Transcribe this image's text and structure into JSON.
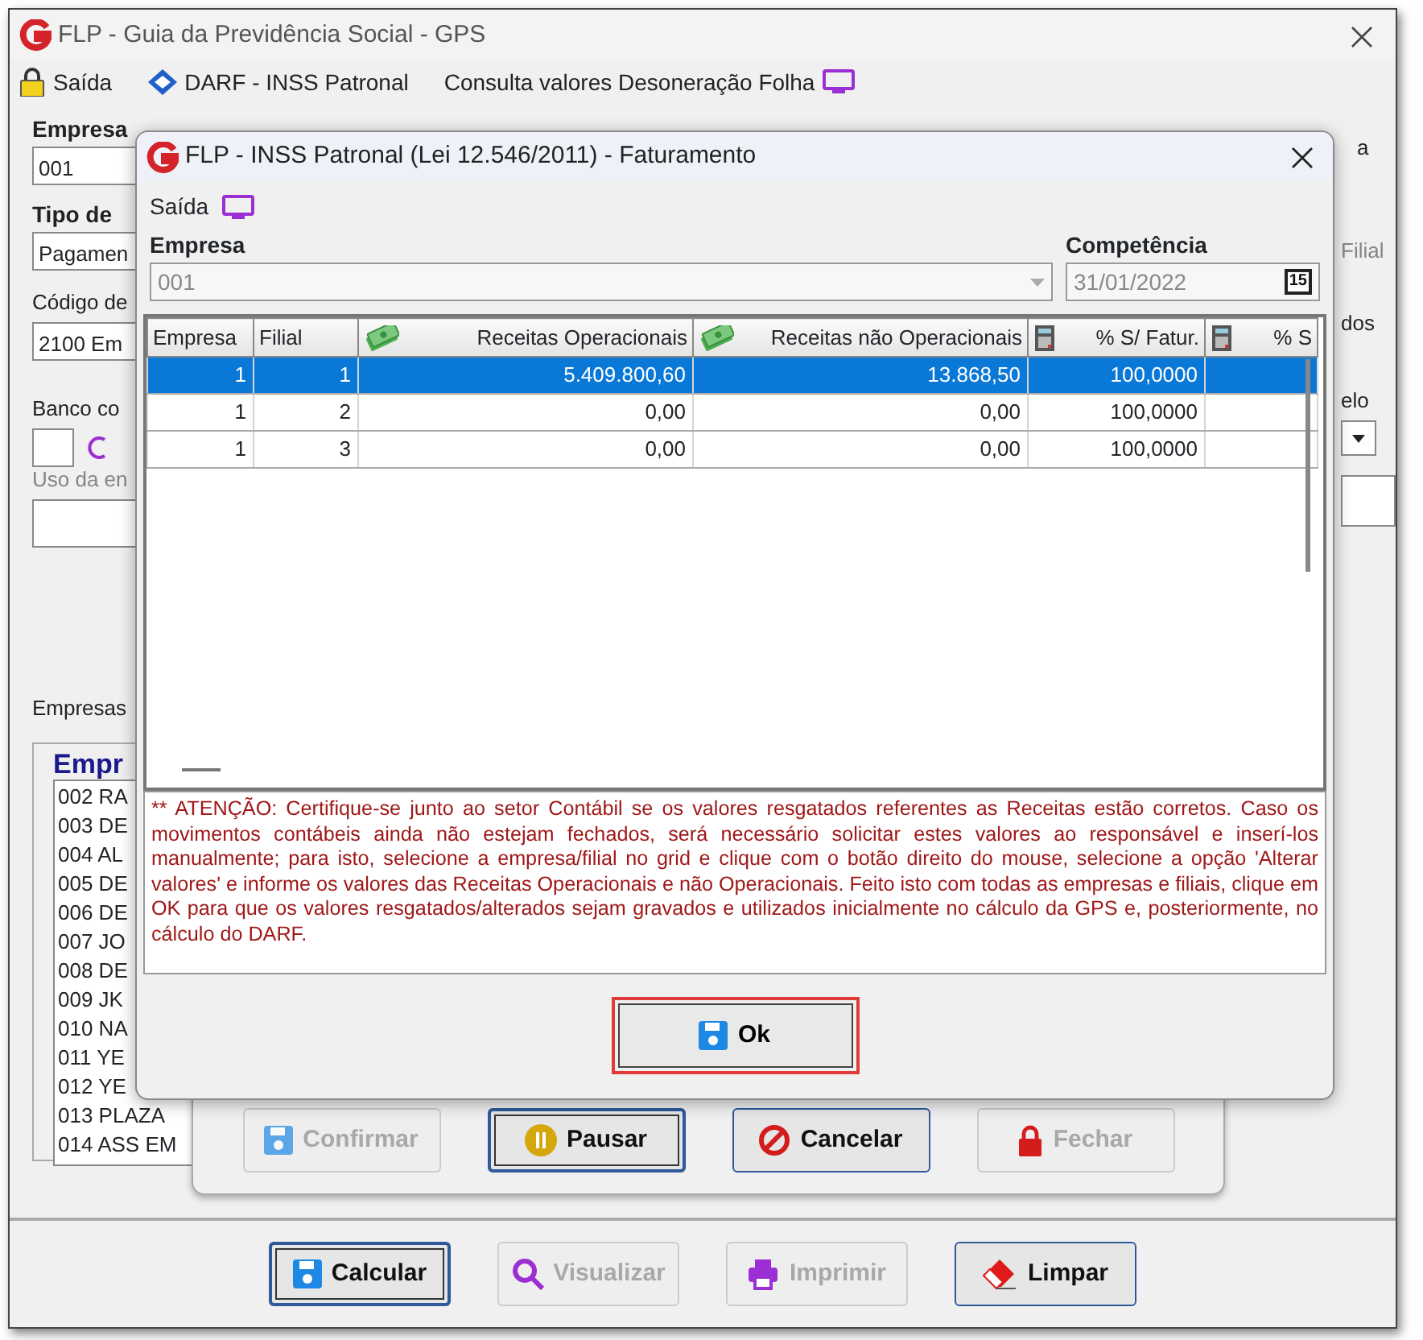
{
  "window": {
    "title": "FLP - Guia da Previdência Social - GPS"
  },
  "menu": [
    {
      "label": "Saída",
      "kind": "lock"
    },
    {
      "label": "DARF - INSS Patronal",
      "kind": "darf"
    },
    {
      "label": "Consulta valores Desoneração Folha",
      "kind": "monitor"
    }
  ],
  "main_form": {
    "empresa_label": "Empresa",
    "empresa_value": "001",
    "tipo_label": "Tipo de",
    "tipo_value": "Pagamen",
    "codigo_label": "Código de",
    "codigo_value": "2100  Em",
    "banco_label": "Banco co",
    "uso_label": "Uso da en",
    "tab": "Empresas",
    "list_header": "Empr",
    "list_items": [
      "002 RA",
      "003 DE",
      "004 AL",
      "005 DE",
      "006 DE",
      "007 JO",
      "008 DE",
      "009 JK",
      "010 NA",
      "011 YE",
      "012 YE",
      "013 PLAZA",
      "014 ASS EM"
    ]
  },
  "right_fragments": {
    "option": "a",
    "filial": "Filial",
    "dos": "dos",
    "elo": "elo"
  },
  "dialog": {
    "title": "FLP - INSS Patronal (Lei 12.546/2011) - Faturamento",
    "menu_label": "Saída",
    "empresa_label": "Empresa",
    "empresa_value": "001",
    "competencia_label": "Competência",
    "competencia_value": "31/01/2022",
    "calendar_day": "15",
    "grid": {
      "columns": [
        {
          "label": "Empresa"
        },
        {
          "label": "Filial"
        },
        {
          "label": "Receitas Operacionais"
        },
        {
          "label": "Receitas não Operacionais"
        },
        {
          "label": "% S/ Fatur."
        },
        {
          "label": "% S"
        }
      ],
      "rows": [
        {
          "selected": true,
          "cells": [
            "1",
            "1",
            "5.409.800,60",
            "13.868,50",
            "100,0000",
            ""
          ]
        },
        {
          "selected": false,
          "cells": [
            "1",
            "2",
            "0,00",
            "0,00",
            "100,0000",
            ""
          ]
        },
        {
          "selected": false,
          "cells": [
            "1",
            "3",
            "0,00",
            "0,00",
            "100,0000",
            ""
          ]
        }
      ]
    },
    "notice": "** ATENÇÃO:  Certifique-se junto ao setor Contábil se os valores resgatados referentes as Receitas estão corretos. Caso os movimentos contábeis ainda não estejam fechados, será necessário solicitar estes valores ao responsável e inserí-los manualmente; para isto, selecione a empresa/filial no grid e clique com o botão direito do mouse, selecione a opção 'Alterar valores' e informe os valores das Receitas Operacionais e não Operacionais.   Feito isto com todas as empresas e filiais, clique em OK para que os valores resgatados/alterados sejam gravados e utilizados inicialmente no cálculo da GPS e, posteriormente, no cálculo do DARF.",
    "ok_button": "Ok"
  },
  "progress_buttons": [
    {
      "label": "Confirmar",
      "kind": "floppy",
      "disabled": true,
      "focused": false
    },
    {
      "label": "Pausar",
      "kind": "pause",
      "disabled": false,
      "focused": true
    },
    {
      "label": "Cancelar",
      "kind": "cancel",
      "disabled": false,
      "focused": false
    },
    {
      "label": "Fechar",
      "kind": "lock",
      "disabled": true,
      "focused": false
    }
  ],
  "bottom_buttons": [
    {
      "label": "Calcular",
      "kind": "floppy",
      "disabled": false,
      "focused": true
    },
    {
      "label": "Visualizar",
      "kind": "search",
      "disabled": true,
      "focused": false
    },
    {
      "label": "Imprimir",
      "kind": "printer",
      "disabled": true,
      "focused": false
    },
    {
      "label": "Limpar",
      "kind": "eraser",
      "disabled": false,
      "focused": false
    }
  ]
}
